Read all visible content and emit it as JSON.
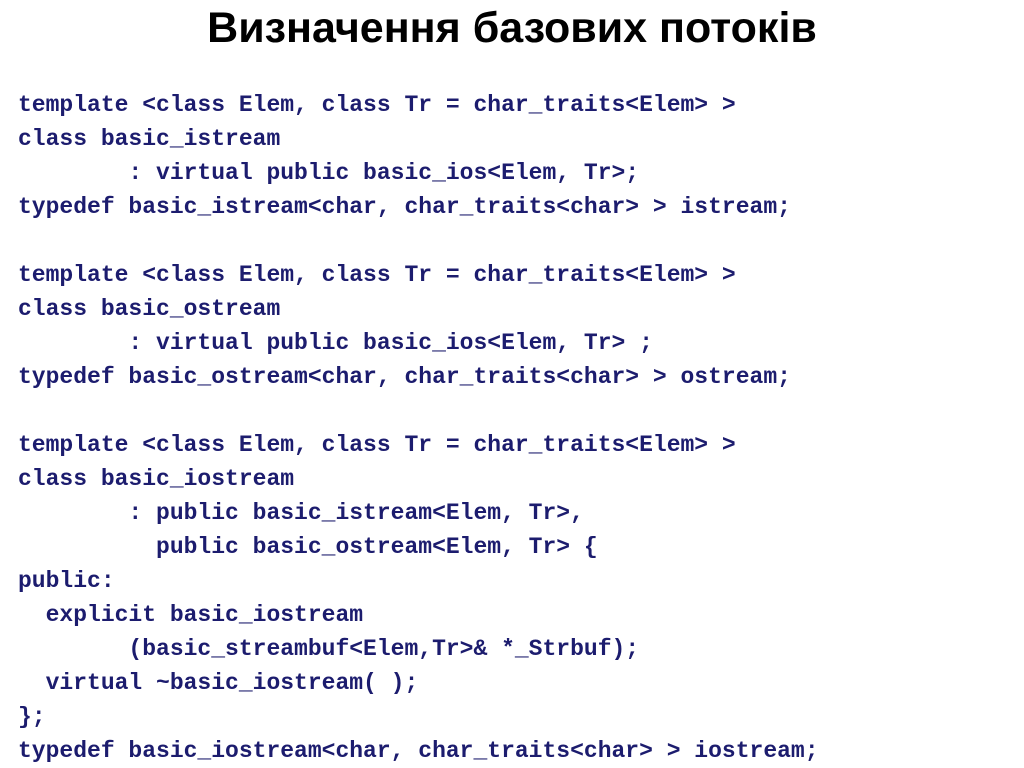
{
  "slide": {
    "title": "Визначення базових потоків",
    "title_color": "#000000",
    "background_color": "#ffffff",
    "code_color": "#1c1c6e",
    "code_lines": [
      "template <class Elem, class Tr = char_traits<Elem> >",
      "class basic_istream",
      "        : virtual public basic_ios<Elem, Tr>;",
      "typedef basic_istream<char, char_traits<char> > istream;",
      "",
      "template <class Elem, class Tr = char_traits<Elem> >",
      "class basic_ostream",
      "        : virtual public basic_ios<Elem, Tr> ;",
      "typedef basic_ostream<char, char_traits<char> > ostream;",
      "",
      "template <class Elem, class Tr = char_traits<Elem> >",
      "class basic_iostream",
      "        : public basic_istream<Elem, Tr>,",
      "          public basic_ostream<Elem, Tr> {",
      "public:",
      "  explicit basic_iostream",
      "        (basic_streambuf<Elem,Tr>& *_Strbuf);",
      "  virtual ~basic_iostream( );",
      "};",
      "typedef basic_iostream<char, char_traits<char> > iostream;"
    ]
  }
}
